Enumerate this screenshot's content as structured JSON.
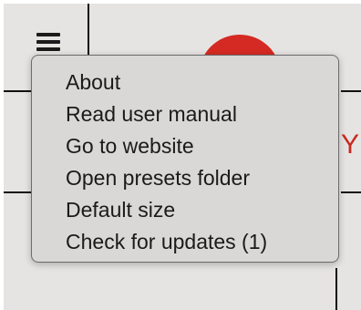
{
  "menu": {
    "items": [
      {
        "label": "About"
      },
      {
        "label": "Read user manual"
      },
      {
        "label": "Go to website"
      },
      {
        "label": "Open presets folder"
      },
      {
        "label": "Default size"
      },
      {
        "label": "Check for updates (1)"
      }
    ]
  },
  "background": {
    "partial_text": "Y"
  },
  "colors": {
    "accent_red": "#d42a23",
    "menu_background": "#d9d8d6",
    "app_background": "#e6e4e2"
  },
  "icons": {
    "menu_toggle": "hamburger-icon"
  }
}
